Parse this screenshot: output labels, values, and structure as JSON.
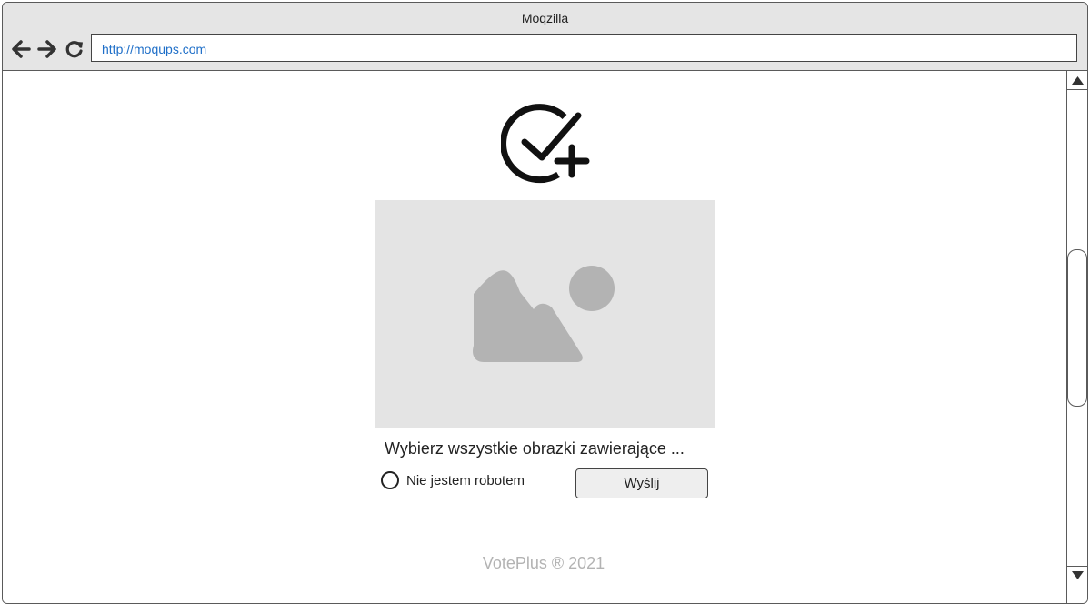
{
  "browser": {
    "title": "Moqzilla",
    "url": "http://moqups.com",
    "nav": {
      "back_icon": "arrow-left-icon",
      "forward_icon": "arrow-right-icon",
      "reload_icon": "reload-icon"
    }
  },
  "page": {
    "logo_icon": "check-circle-plus-icon",
    "image_icon": "image-placeholder-icon",
    "instruction": "Wybierz wszystkie obrazki zawierające ...",
    "captcha": {
      "label": "Nie jestem robotem",
      "checked": false
    },
    "submit_label": "Wyślij",
    "footer": "VotePlus ® 2021"
  },
  "colors": {
    "chrome_bg": "#e5e5e5",
    "url_text": "#1f6fc8",
    "placeholder_bg": "#e4e4e4",
    "placeholder_shape": "#b3b3b3",
    "footer_text": "#b3b3b3"
  }
}
